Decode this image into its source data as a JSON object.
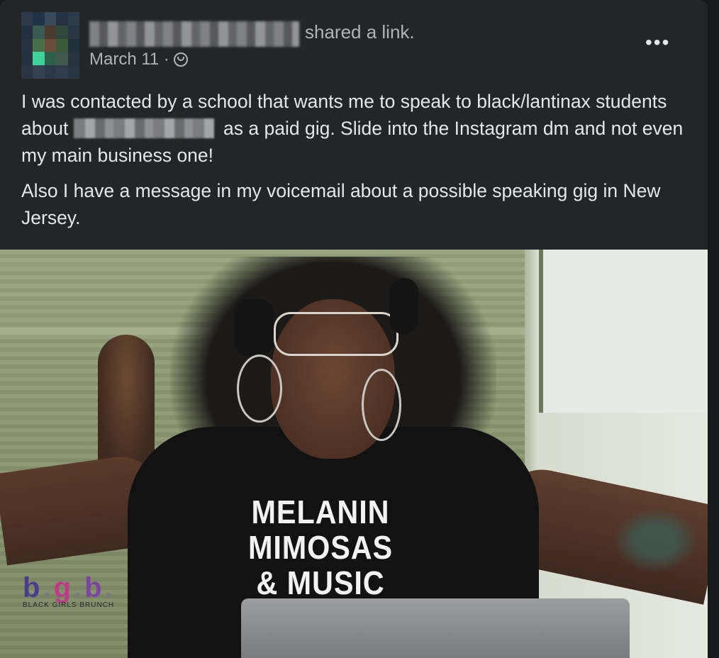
{
  "post": {
    "author_action": "shared a link.",
    "date": "March 11 ·",
    "more_label": "•••",
    "paragraph1_before": "I was contacted by a school that wants me to speak to black/lantinax students about ",
    "paragraph1_after": " as a paid gig. Slide into the Instagram dm and not even my main business one!",
    "paragraph2": "Also I have a message in my voicemail about a possible speaking gig in New Jersey."
  },
  "media": {
    "shirt_line1": "MELANIN",
    "shirt_line2": "MIMOSAS",
    "shirt_line3": "& MUSIC",
    "logo_b1": "b",
    "logo_g": "g",
    "logo_b2": "b",
    "logo_tagline": "BLACK GIRLS BRUNCH"
  },
  "icons": {
    "privacy": "globe-icon",
    "more": "more-options-icon"
  }
}
